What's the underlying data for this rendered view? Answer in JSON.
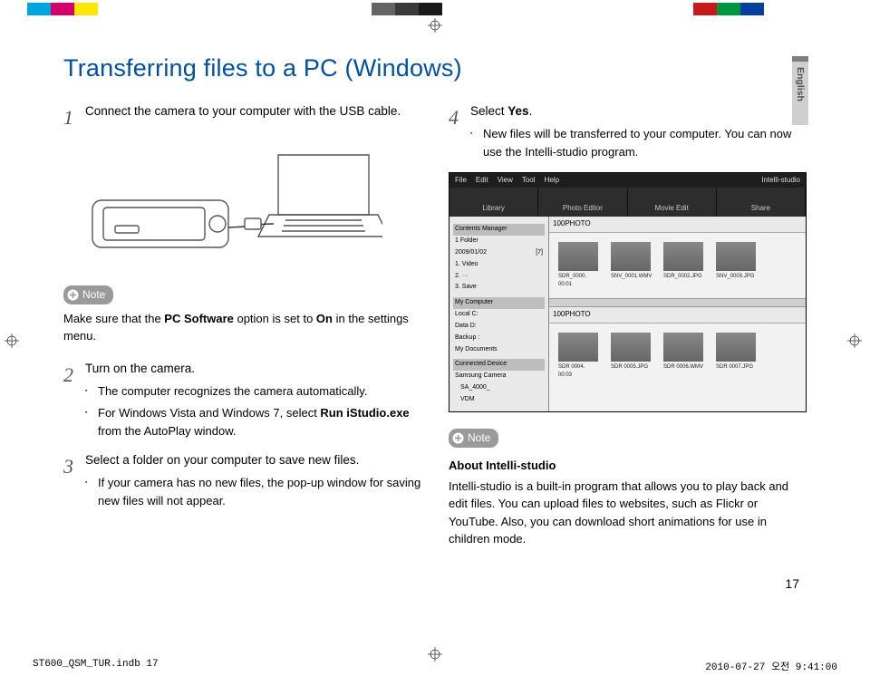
{
  "title": "Transferring files to a PC (Windows)",
  "language_tab": "English",
  "steps": {
    "s1": {
      "num": "1",
      "text": "Connect the camera to your computer with the USB cable."
    },
    "s2": {
      "num": "2",
      "text": "Turn on the camera.",
      "b1": "The computer recognizes the camera automatically.",
      "b2_pre": "For Windows Vista and Windows 7, select ",
      "b2_bold": "Run iStudio.exe",
      "b2_post": " from the AutoPlay window."
    },
    "s3": {
      "num": "3",
      "text": "Select a folder on your computer to save new files.",
      "b1": "If your camera has no new files, the pop-up window for saving new files will not appear."
    },
    "s4": {
      "num": "4",
      "text_pre": "Select ",
      "text_bold": "Yes",
      "text_post": ".",
      "b1": "New files will be transferred to your computer. You can now use the Intelli-studio program."
    }
  },
  "note1": {
    "label": "Note",
    "text_pre": "Make sure that the ",
    "bold1": "PC Software",
    "mid": " option is set to ",
    "bold2": "On",
    "post": " in the settings menu."
  },
  "note2": {
    "label": "Note",
    "heading": "About Intelli-studio",
    "text": "Intelli-studio is a built-in program that allows you to play back and edit files. You can upload files to websites, such as Flickr or YouTube. Also, you can download short animations for use in children mode."
  },
  "screenshot": {
    "app_title": "Intelli-studio",
    "menu": [
      "File",
      "Edit",
      "View",
      "Tool",
      "Help"
    ],
    "tabs": [
      "Library",
      "Photo Editor",
      "Movie Edit",
      "Share"
    ],
    "side": {
      "contents_manager": "Contents Manager",
      "folder1": "1 Folder",
      "date1": "2009/01/02",
      "count1": "[7]",
      "sub1": "1. Video",
      "sub2": "2. ···",
      "sub3": "3. Save",
      "my_computer": "My Computer",
      "items": [
        "Local C:",
        "Data D:",
        "Backup :",
        "My Documents"
      ],
      "connected_device": "Connected Device",
      "device": "Samsung Camera",
      "dev_items": [
        "SA_4000_",
        "VDM"
      ]
    },
    "main": {
      "crumb_top": "100PHOTO",
      "thumbs_top": [
        "SDR_0000.  00:01",
        "SNV_0001.WMV",
        "SDR_0002.JPG",
        "SNV_0003.JPG"
      ],
      "crumb_mid": "100PHOTO",
      "thumbs_mid": [
        "SDR 0004.  00:03",
        "SDR 0005.JPG",
        "SDR 0006.WMV",
        "SDR 0007.JPG"
      ]
    }
  },
  "page_number": "17",
  "footer": {
    "left": "ST600_QSM_TUR.indb   17",
    "right": "2010-07-27   오전 9:41:00"
  }
}
